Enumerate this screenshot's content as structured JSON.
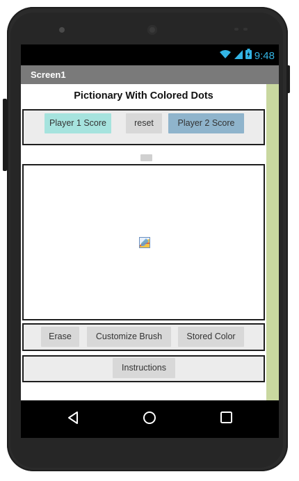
{
  "status_bar": {
    "time": "9:48",
    "icons": [
      "wifi-icon",
      "signal-icon",
      "battery-icon"
    ]
  },
  "screen_title": "Screen1",
  "app": {
    "title": "Pictionary With Colored Dots",
    "score_row": {
      "player1_label": "Player 1 Score",
      "reset_label": "reset",
      "player2_label": "Player 2 Score"
    },
    "tool_row": {
      "erase_label": "Erase",
      "customize_label": "Customize Brush",
      "stored_color_label": "Stored Color"
    },
    "instructions_label": "Instructions"
  },
  "nav": {
    "icons": [
      "back-icon",
      "home-icon",
      "recents-icon"
    ]
  },
  "colors": {
    "player1_button": "#a6e3de",
    "player2_button": "#8fb4cc",
    "screen_right_bar": "#c9d8a0",
    "title_bar": "#7a7a7a",
    "status_time": "#33b5e5"
  }
}
